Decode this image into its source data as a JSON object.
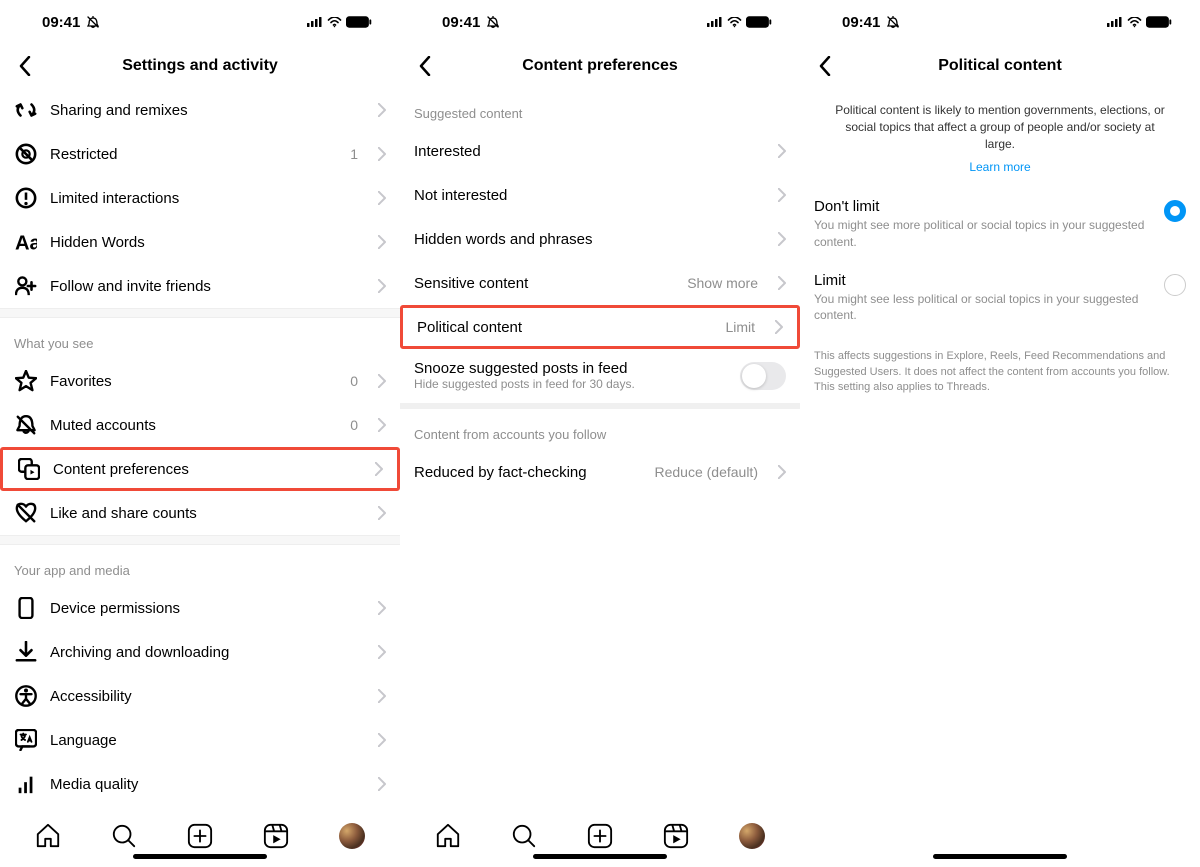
{
  "status": {
    "time": "09:41"
  },
  "screen1": {
    "title": "Settings and activity",
    "items_top": [
      {
        "icon": "remix",
        "label": "Sharing and remixes"
      },
      {
        "icon": "restricted",
        "label": "Restricted",
        "value": "1"
      },
      {
        "icon": "limited",
        "label": "Limited interactions"
      },
      {
        "icon": "aa",
        "label": "Hidden Words"
      },
      {
        "icon": "follow",
        "label": "Follow and invite friends"
      }
    ],
    "section_see": "What you see",
    "items_see": [
      {
        "icon": "star",
        "label": "Favorites",
        "value": "0"
      },
      {
        "icon": "bell-off",
        "label": "Muted accounts",
        "value": "0"
      },
      {
        "icon": "content",
        "label": "Content preferences",
        "highlight": true
      },
      {
        "icon": "heart-off",
        "label": "Like and share counts"
      }
    ],
    "section_app": "Your app and media",
    "items_app": [
      {
        "icon": "device",
        "label": "Device permissions"
      },
      {
        "icon": "download",
        "label": "Archiving and downloading"
      },
      {
        "icon": "accessibility",
        "label": "Accessibility"
      },
      {
        "icon": "language",
        "label": "Language"
      },
      {
        "icon": "media",
        "label": "Media quality"
      }
    ]
  },
  "screen2": {
    "title": "Content preferences",
    "section_suggested": "Suggested content",
    "items_suggested": [
      {
        "label": "Interested"
      },
      {
        "label": "Not interested"
      },
      {
        "label": "Hidden words and phrases"
      },
      {
        "label": "Sensitive content",
        "value": "Show more"
      },
      {
        "label": "Political content",
        "value": "Limit",
        "highlight": true
      }
    ],
    "snooze": {
      "label": "Snooze suggested posts in feed",
      "sub": "Hide suggested posts in feed for 30 days."
    },
    "section_follow": "Content from accounts you follow",
    "items_follow": [
      {
        "label": "Reduced by fact-checking",
        "value": "Reduce (default)"
      }
    ]
  },
  "screen3": {
    "title": "Political content",
    "description": "Political content is likely to mention governments, elections, or social topics that affect a group of people and/or society at large.",
    "learn_more": "Learn more",
    "options": [
      {
        "title": "Don't limit",
        "desc": "You might see more political or social topics in your suggested content.",
        "selected": true
      },
      {
        "title": "Limit",
        "desc": "You might see less political or social topics in your suggested content.",
        "selected": false
      }
    ],
    "footer": "This affects suggestions in Explore, Reels, Feed Recommendations and Suggested Users. It does not affect the content from accounts you follow. This setting also applies to Threads."
  }
}
